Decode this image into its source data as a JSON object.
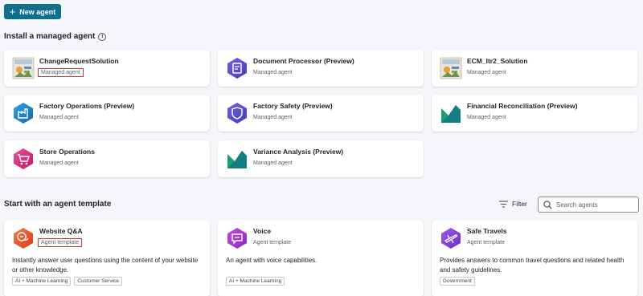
{
  "toolbar": {
    "new_agent_label": "New agent"
  },
  "managed_section": {
    "title": "Install a managed agent",
    "cards": [
      {
        "title": "ChangeRequestSolution",
        "subtitle": "Managed agent",
        "icon": "image-thumbnail-icon",
        "highlight": true
      },
      {
        "title": "Document Processor (Preview)",
        "subtitle": "Managed agent",
        "icon": "document-processor-icon"
      },
      {
        "title": "ECM_Itr2_Solution",
        "subtitle": "Managed agent",
        "icon": "image-thumbnail-icon"
      },
      {
        "title": "Factory Operations (Preview)",
        "subtitle": "Managed agent",
        "icon": "factory-icon"
      },
      {
        "title": "Factory Safety (Preview)",
        "subtitle": "Managed agent",
        "icon": "safety-shield-icon"
      },
      {
        "title": "Financial Reconciliation (Preview)",
        "subtitle": "Managed agent",
        "icon": "chart-icon"
      },
      {
        "title": "Store Operations",
        "subtitle": "Managed agent",
        "icon": "shopping-cart-icon"
      },
      {
        "title": "Variance Analysis (Preview)",
        "subtitle": "Managed agent",
        "icon": "chart-icon"
      }
    ]
  },
  "template_section": {
    "title": "Start with an agent template",
    "filter_label": "Filter",
    "search_placeholder": "Search agents",
    "cards": [
      {
        "title": "Website Q&A",
        "subtitle": "Agent template",
        "highlight": true,
        "description": "Instantly answer user questions using the content of your website or other knowledge.",
        "tags": [
          "AI + Machine Learning",
          "Customer Service"
        ],
        "icon": "chat-bubble-icon"
      },
      {
        "title": "Voice",
        "subtitle": "Agent template",
        "description": "An agent with voice capabilities.",
        "tags": [
          "AI + Machine Learning"
        ],
        "icon": "voice-chat-icon"
      },
      {
        "title": "Safe Travels",
        "subtitle": "Agent template",
        "description": "Provides answers to common travel questions and related health and safety guidelines.",
        "tags": [
          "Government"
        ],
        "icon": "airplane-icon"
      }
    ]
  },
  "colors": {
    "primary_button": "#0f6f8c",
    "highlight_border": "#d13438",
    "icon_purple": "#6b3fd6",
    "icon_blue": "#1e88c8",
    "icon_pink": "#d6287a",
    "icon_orange": "#e8582a",
    "icon_green": "#1a9e74"
  }
}
